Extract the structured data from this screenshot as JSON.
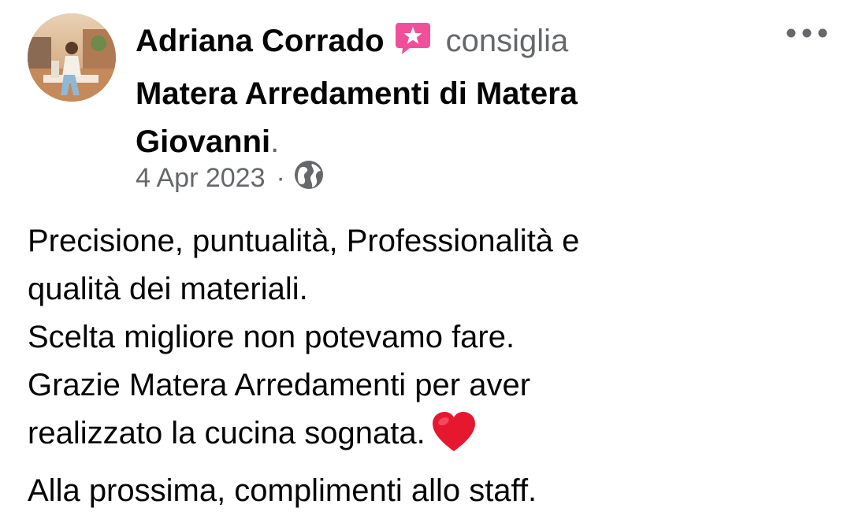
{
  "post": {
    "author": "Adriana Corrado",
    "verb": "consiglia",
    "page_name_line1": "Matera Arredamenti di Matera",
    "page_name_line2": "Giovanni",
    "page_name_end": ".",
    "date": "4 Apr 2023",
    "separator": "·",
    "privacy_icon": "globe-icon",
    "review_icon": "recommendation-icon",
    "more_icon": "more-options-icon",
    "body_lines": [
      "Precisione, puntualità, Professionalità e",
      "qualità dei materiali.",
      "Scelta migliore non potevamo fare.",
      "Grazie Matera Arredamenti per aver",
      "realizzato la cucina sognata.",
      "Alla prossima, complimenti allo staff."
    ],
    "body_emoji": "heart-emoji"
  },
  "colors": {
    "text_primary": "#050505",
    "text_secondary": "#65676b",
    "recommend_pink": "#f0509a",
    "heart_red": "#e6182f"
  }
}
